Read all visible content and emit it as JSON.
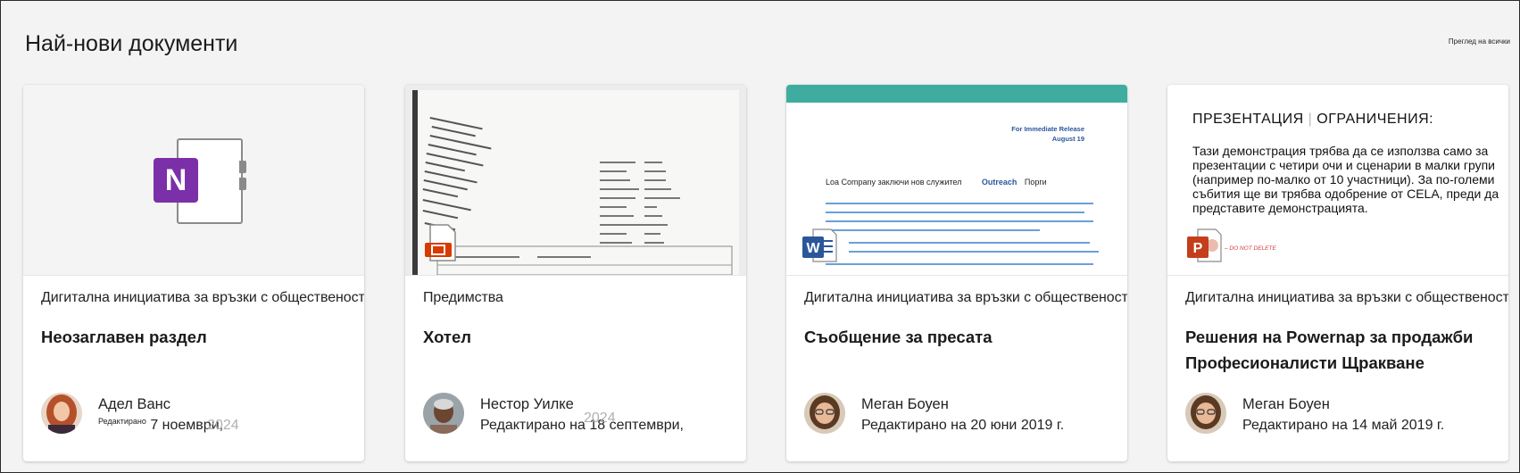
{
  "section": {
    "title": "Най-нови документи",
    "see_all": "Преглед на всички"
  },
  "cards": [
    {
      "notebook": "Дигитална инициатива за връзки с обществеността",
      "title": "Неозаглавен раздел",
      "author": "Адел Ванс",
      "edited_prefix": "Редактирано",
      "edited_date": "7 ноември,",
      "edited_year": "2024",
      "thumb_type": "onenote",
      "app_icon": "onenote-icon"
    },
    {
      "notebook": "Предимства",
      "title": "Хотел",
      "author": "Нестор Уилке",
      "edited_prefix": "Редактирано на",
      "edited_date": "18 септември,",
      "edited_year": "2024",
      "thumb_type": "receipt",
      "app_icon": "pdf-icon"
    },
    {
      "notebook": "Дигитална инициатива за връзки с обществеността",
      "title": "Съобщение за пресата",
      "author": "Меган Боуен",
      "edited": "Редактирано на 20 юни 2019 г.",
      "thumb_type": "word",
      "app_icon": "word-icon",
      "thumb_text": {
        "release": "For Immediate Release",
        "date": "August 19",
        "headline_a": "Loa Company заключи нов служител",
        "headline_b": "Outreach",
        "headline_c": "Порги"
      }
    },
    {
      "notebook": "Дигитална инициатива за връзки с обществеността",
      "title": "Решения на Powernap за продажби Професионалисти Щракване",
      "author": "Меган Боуен",
      "edited": "Редактирано на 14 май 2019 г.",
      "thumb_type": "powerpoint",
      "app_icon": "powerpoint-icon",
      "thumb_text": {
        "heading_a": "ПРЕЗЕНТАЦИЯ",
        "heading_b": "ОГРАНИЧЕНИЯ:",
        "body": "Тази демонстрация трябва да се използва само за презентации с четири очи и сценарии в малки групи (например по-малко от 10 участници). За по-големи събития ще ви трябва одобрение от CELA, преди да представите демонстрацията.",
        "stamp": "– DO NOT DELETE"
      }
    }
  ],
  "colors": {
    "onenote": "#7b2fa8",
    "word": "#2b579a",
    "powerpoint": "#c43e1c",
    "pdf": "#d83b01",
    "accent_band": "#3eada0"
  }
}
